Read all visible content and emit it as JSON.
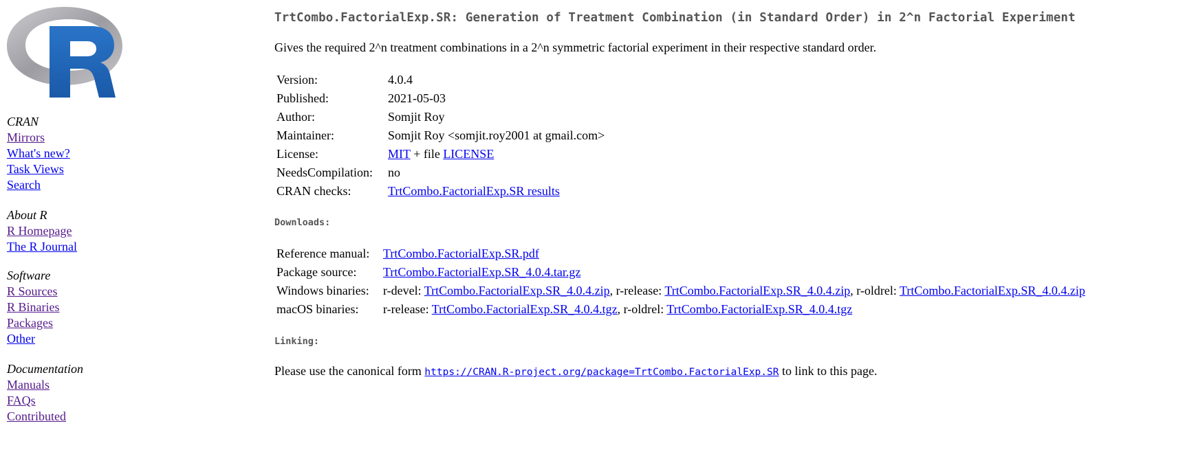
{
  "sidebar": {
    "cran": {
      "heading": "CRAN",
      "links": [
        "Mirrors",
        "What's new?",
        "Task Views",
        "Search"
      ]
    },
    "about": {
      "heading": "About R",
      "links": [
        "R Homepage",
        "The R Journal"
      ]
    },
    "software": {
      "heading": "Software",
      "links": [
        "R Sources",
        "R Binaries",
        "Packages",
        "Other"
      ]
    },
    "documentation": {
      "heading": "Documentation",
      "links": [
        "Manuals",
        "FAQs",
        "Contributed"
      ]
    }
  },
  "package": {
    "title": "TrtCombo.FactorialExp.SR: Generation of Treatment Combination (in Standard Order) in 2^n Factorial Experiment",
    "description": "Gives the required 2^n treatment combinations in a 2^n symmetric factorial experiment in their respective standard order.",
    "meta": {
      "version_label": "Version:",
      "version": "4.0.4",
      "published_label": "Published:",
      "published": "2021-05-03",
      "author_label": "Author:",
      "author": "Somjit Roy",
      "maintainer_label": "Maintainer:",
      "maintainer": "Somjit Roy <somjit.roy2001 at gmail.com>",
      "license_label": "License:",
      "license_mit": "MIT",
      "license_mid": " + file ",
      "license_file": "LICENSE",
      "needs_compilation_label": "NeedsCompilation:",
      "needs_compilation": "no",
      "cran_checks_label": "CRAN checks:",
      "cran_checks_link": "TrtCombo.FactorialExp.SR results"
    }
  },
  "downloads": {
    "heading": "Downloads:",
    "reference_manual_label": "Reference manual:",
    "reference_manual_link": "TrtCombo.FactorialExp.SR.pdf",
    "package_source_label": "Package source:",
    "package_source_link": "TrtCombo.FactorialExp.SR_4.0.4.tar.gz",
    "windows_label": "Windows binaries:",
    "windows_devel_prefix": "r-devel: ",
    "windows_devel_link": "TrtCombo.FactorialExp.SR_4.0.4.zip",
    "windows_release_prefix": ", r-release: ",
    "windows_release_link": "TrtCombo.FactorialExp.SR_4.0.4.zip",
    "windows_oldrel_prefix": ", r-oldrel: ",
    "windows_oldrel_link": "TrtCombo.FactorialExp.SR_4.0.4.zip",
    "macos_label": "macOS binaries:",
    "macos_release_prefix": "r-release: ",
    "macos_release_link": "TrtCombo.FactorialExp.SR_4.0.4.tgz",
    "macos_oldrel_prefix": ", r-oldrel: ",
    "macos_oldrel_link": "TrtCombo.FactorialExp.SR_4.0.4.tgz"
  },
  "linking": {
    "heading": "Linking:",
    "prefix": "Please use the canonical form ",
    "url": "https://CRAN.R-project.org/package=TrtCombo.FactorialExp.SR",
    "suffix": " to link to this page."
  },
  "colors": {
    "link": "#0000ee",
    "visited_link": "#551a8b",
    "title": "#555555",
    "logo_blue": "#1f65b7",
    "logo_gray": "#a8a8ad"
  }
}
